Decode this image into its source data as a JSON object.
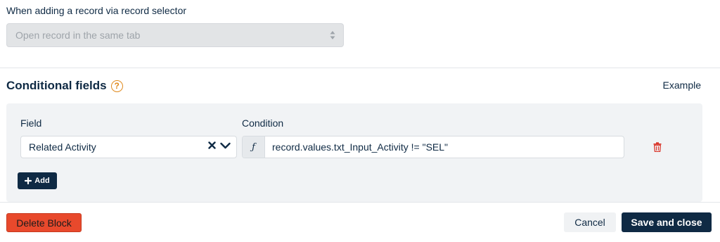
{
  "record_selector": {
    "label": "When adding a record via record selector",
    "selected_value": "Open record in the same tab"
  },
  "conditional_fields": {
    "title": "Conditional fields",
    "help_symbol": "?",
    "example_link": "Example",
    "field_header": "Field",
    "condition_header": "Condition",
    "rows": [
      {
        "field": "Related Activity",
        "condition_prefix": "ƒ",
        "condition": "record.values.txt_Input_Activity != \"SEL\""
      }
    ],
    "add_label": "Add"
  },
  "footer": {
    "delete_label": "Delete Block",
    "cancel_label": "Cancel",
    "save_label": "Save and close"
  },
  "colors": {
    "primary": "#0f2a44",
    "danger": "#e8492c",
    "help_accent": "#e08a1e",
    "trash": "#d9352a"
  }
}
